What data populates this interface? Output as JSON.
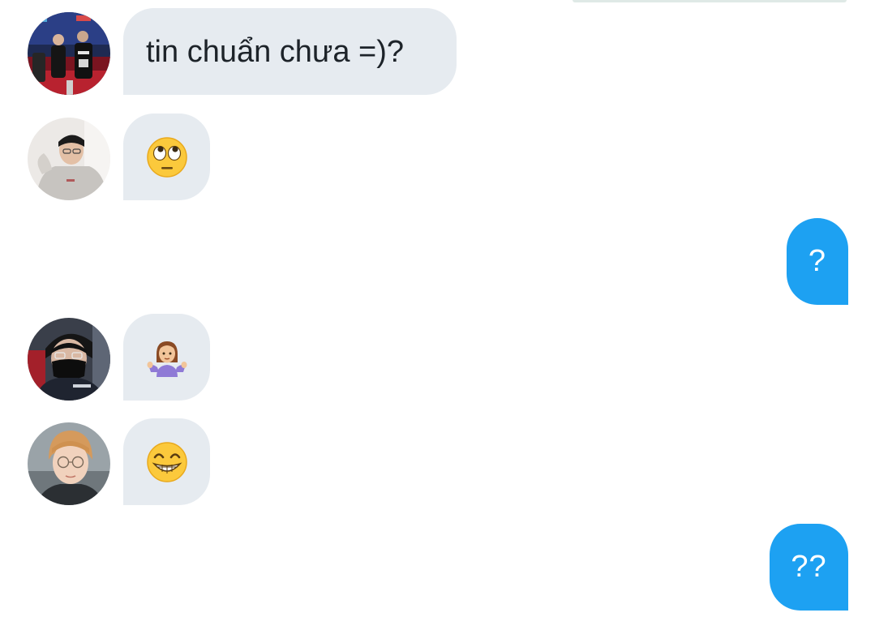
{
  "conversation": {
    "messages": [
      {
        "direction": "incoming",
        "kind": "text",
        "avatar_icon": "avatar-photo-stage-jerseys",
        "text": "tin chuẩn chưa =)?"
      },
      {
        "direction": "incoming",
        "kind": "emoji",
        "avatar_icon": "avatar-photo-hoodie-glasses",
        "emoji_icon": "face-with-rolling-eyes-emoji"
      },
      {
        "direction": "outgoing",
        "kind": "text",
        "text": "?"
      },
      {
        "direction": "incoming",
        "kind": "emoji",
        "avatar_icon": "avatar-photo-black-mask",
        "emoji_icon": "person-shrugging-emoji"
      },
      {
        "direction": "incoming",
        "kind": "emoji",
        "avatar_icon": "avatar-photo-round-glasses",
        "emoji_icon": "beaming-face-emoji"
      },
      {
        "direction": "outgoing",
        "kind": "text",
        "text": "??"
      }
    ]
  },
  "colors": {
    "incoming_bubble": "#e6ebf0",
    "outgoing_bubble": "#1da1f2",
    "incoming_text": "#1d2329",
    "outgoing_text": "#ffffff",
    "background": "#ffffff"
  }
}
